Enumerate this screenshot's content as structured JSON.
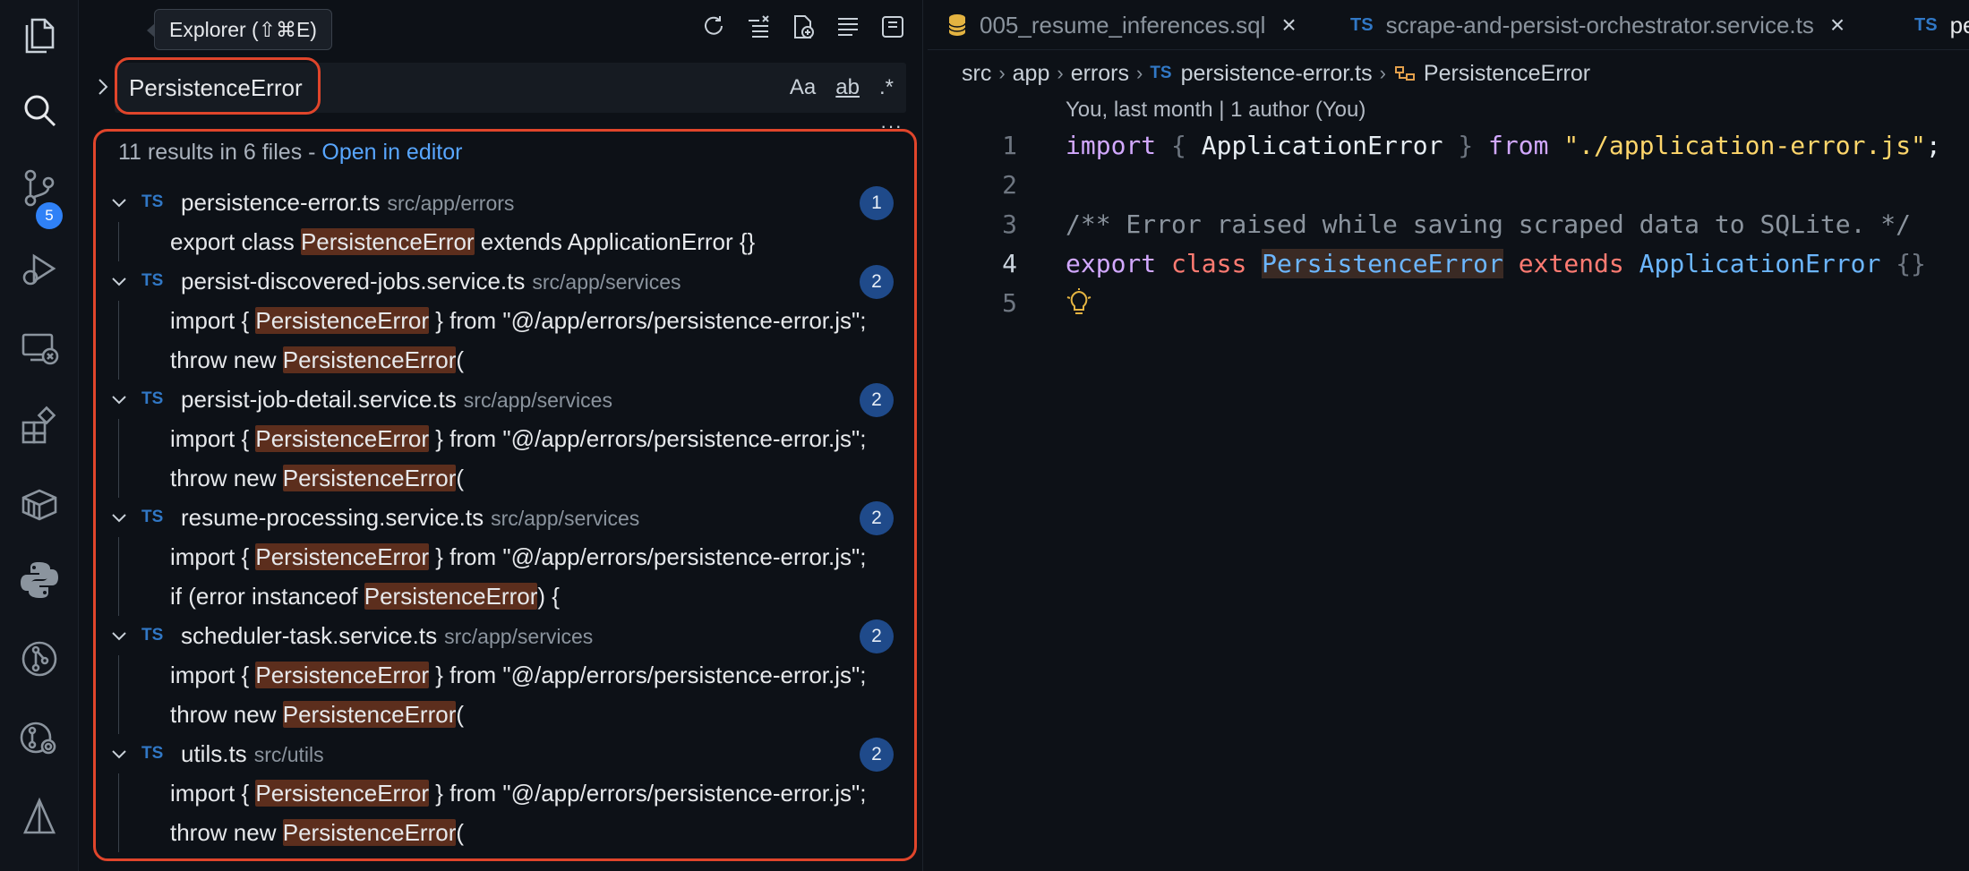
{
  "activity_bar": {
    "scm_badge": "5",
    "items": [
      "explorer",
      "search",
      "source-control",
      "run-debug",
      "remote-explorer",
      "extensions",
      "containers",
      "python",
      "git-graph",
      "git-lens",
      "warp"
    ]
  },
  "tooltip": "Explorer (⇧⌘E)",
  "search": {
    "query": "PersistenceError",
    "opt_case": "Aa",
    "opt_word": "ab",
    "opt_regex": ".*",
    "summary_prefix": "11 results in 6 files - ",
    "summary_link": "Open in editor",
    "more": "···"
  },
  "results": [
    {
      "file": "persistence-error.ts",
      "path": "src/app/errors",
      "count": "1",
      "matches": [
        {
          "pre": "export class ",
          "hit": "PersistenceError",
          "post": " extends ApplicationError {}"
        }
      ]
    },
    {
      "file": "persist-discovered-jobs.service.ts",
      "path": "src/app/services",
      "count": "2",
      "matches": [
        {
          "pre": "import { ",
          "hit": "PersistenceError",
          "post": " } from \"@/app/errors/persistence-error.js\";"
        },
        {
          "pre": "throw new ",
          "hit": "PersistenceError",
          "post": "("
        }
      ]
    },
    {
      "file": "persist-job-detail.service.ts",
      "path": "src/app/services",
      "count": "2",
      "matches": [
        {
          "pre": "import { ",
          "hit": "PersistenceError",
          "post": " } from \"@/app/errors/persistence-error.js\";"
        },
        {
          "pre": "throw new ",
          "hit": "PersistenceError",
          "post": "("
        }
      ]
    },
    {
      "file": "resume-processing.service.ts",
      "path": "src/app/services",
      "count": "2",
      "matches": [
        {
          "pre": "import { ",
          "hit": "PersistenceError",
          "post": " } from \"@/app/errors/persistence-error.js\";"
        },
        {
          "pre": "if (error instanceof ",
          "hit": "PersistenceError",
          "post": ") {"
        }
      ]
    },
    {
      "file": "scheduler-task.service.ts",
      "path": "src/app/services",
      "count": "2",
      "matches": [
        {
          "pre": "import { ",
          "hit": "PersistenceError",
          "post": " } from \"@/app/errors/persistence-error.js\";"
        },
        {
          "pre": "throw new ",
          "hit": "PersistenceError",
          "post": "("
        }
      ]
    },
    {
      "file": "utils.ts",
      "path": "src/utils",
      "count": "2",
      "matches": [
        {
          "pre": "import { ",
          "hit": "PersistenceError",
          "post": " } from \"@/app/errors/persistence-error.js\";"
        },
        {
          "pre": "throw new ",
          "hit": "PersistenceError",
          "post": "("
        }
      ]
    }
  ],
  "ts_label": "TS",
  "editor": {
    "tabs": [
      {
        "label": "005_resume_inferences.sql",
        "icon": "database-icon"
      },
      {
        "label": "scrape-and-persist-orchestrator.service.ts",
        "icon": "TS"
      },
      {
        "label": "pe",
        "icon": "TS"
      }
    ],
    "breadcrumb": [
      "src",
      "app",
      "errors",
      "persistence-error.ts",
      "PersistenceError"
    ],
    "blame": "You, last month | 1 author (You)",
    "lines": {
      "n1": "1",
      "n2": "2",
      "n3": "3",
      "n4": "4",
      "n5": "5",
      "l1": {
        "import": "import",
        "lb": "{",
        "ident": "ApplicationError",
        "rb": "}",
        "from": "from",
        "str": "\"./application-error.js\"",
        "semi": ";"
      },
      "l3": "/** Error raised while saving scraped data to SQLite. */",
      "l4": {
        "export": "export",
        "class": "class",
        "name": "PersistenceError",
        "extends": "extends",
        "base": "ApplicationError",
        "body": "{}"
      }
    }
  }
}
